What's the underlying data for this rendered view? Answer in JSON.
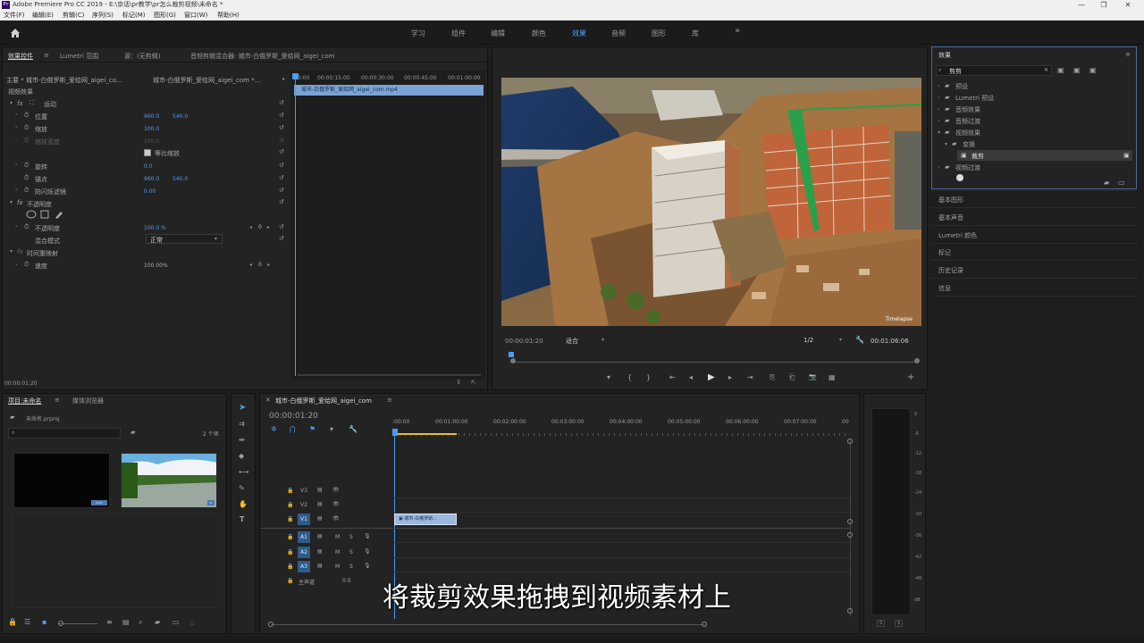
{
  "window": {
    "title": "Adobe Premiere Pro CC 2019 - E:\\京话\\pr教学\\pr怎么裁剪视频\\未命名 *",
    "app_icon": "Pr",
    "controls": [
      "—",
      "❐",
      "✕"
    ]
  },
  "menu": [
    "文件(F)",
    "编辑(E)",
    "剪辑(C)",
    "序列(S)",
    "标记(M)",
    "图形(G)",
    "窗口(W)",
    "帮助(H)"
  ],
  "workspaces": [
    "学习",
    "组件",
    "编辑",
    "颜色",
    "效果",
    "音频",
    "图形",
    "库"
  ],
  "workspace_more": "»",
  "effect_controls": {
    "tabs": [
      "效果控件",
      "Lumetri 范围",
      "源：(无剪辑)",
      "音频剪辑混合器: 城市-白俄罗斯_爱给网_aigei_com"
    ],
    "tab_menu": "≡",
    "master_label": "主要 * 城市-白俄罗斯_爱给网_aigei_co...",
    "clip_label": "城市-白俄罗斯_爱给网_aigei_com *...",
    "video_effects": "视频效果",
    "motion": "运动",
    "rows": [
      {
        "label": "位置",
        "v1": "960.0",
        "v2": "540.0"
      },
      {
        "label": "缩放",
        "v1": "100.0",
        "v2": ""
      },
      {
        "label": "缩放宽度",
        "v1": "100.0",
        "v2": ""
      },
      {
        "label": "等比缩放",
        "v1": "",
        "v2": ""
      },
      {
        "label": "旋转",
        "v1": "0.0",
        "v2": ""
      },
      {
        "label": "锚点",
        "v1": "960.0",
        "v2": "540.0"
      },
      {
        "label": "防闪烁滤镜",
        "v1": "0.00",
        "v2": ""
      }
    ],
    "opacity": "不透明度",
    "opacity_row": {
      "label": "不透明度",
      "value": "100.0 %"
    },
    "blend": {
      "label": "混合模式",
      "value": "正常"
    },
    "time_remap": "时间重映射",
    "speed": {
      "label": "速度",
      "value": "100.00%"
    },
    "keyframe_value": "0",
    "timecode": "00:00:01:20",
    "timeline_marks": [
      "00:00",
      "00:00:15:00",
      "00:00:30:00",
      "00:00:45:00",
      "00:01:00:00"
    ],
    "mini_clip": "城市-白俄罗斯_爱给网_aigei_com.mp4"
  },
  "program": {
    "watermark": "Timelapse",
    "timecode": "00:00:01:20",
    "fit": "适合",
    "resolution": "1/2",
    "duration": "00:01:06:06",
    "transport_icons": [
      "▾",
      "{",
      "}",
      "⇤",
      "◂",
      "▶",
      "▸",
      "⇥",
      "⎘",
      "⎗",
      "📷",
      "▦",
      "+"
    ]
  },
  "effects_panel": {
    "title": "效果",
    "menu": "≡",
    "search_value": "剪剪",
    "clear": "✕",
    "tree": [
      {
        "label": "预设",
        "level": 0
      },
      {
        "label": "Lumetri 预设",
        "level": 0
      },
      {
        "label": "音频效果",
        "level": 0
      },
      {
        "label": "音频过渡",
        "level": 0
      },
      {
        "label": "视频效果",
        "level": 0
      },
      {
        "label": "变换",
        "level": 1
      },
      {
        "label": "裁剪",
        "level": 2
      },
      {
        "label": "视频过渡",
        "level": 0
      }
    ],
    "side_panels": [
      "基本图形",
      "基本声音",
      "Lumetri 颜色",
      "标记",
      "历史记录",
      "信息"
    ]
  },
  "project": {
    "tabs": [
      "项目:未命名",
      "媒体浏览器"
    ],
    "file": "未命名.prproj",
    "count": "2 个项",
    "search_placeholder": "",
    "thumbs": [
      {
        "label": "",
        "badge": "▭▭"
      },
      {
        "label": "",
        "badge": "▭"
      }
    ]
  },
  "timeline": {
    "tab": "城市-白俄罗斯_爱给网_aigei_com",
    "timecode": "00:00:01:20",
    "ruler": [
      ":00:00",
      "00:01:00:00",
      "00:02:00:00",
      "00:03:00:00",
      "00:04:00:00",
      "00:05:00:00",
      "00:06:00:00",
      "00:07:00:00",
      "00"
    ],
    "tracks": [
      "V3",
      "V2",
      "V1",
      "A1",
      "A2",
      "A3"
    ],
    "master": {
      "label": "主声道",
      "value": "0.0"
    },
    "clip_label": "城市-白俄罗斯...",
    "track_flags": [
      "M",
      "S"
    ]
  },
  "subtitle": "将裁剪效果拖拽到视频素材上",
  "meter": {
    "ticks": [
      "0",
      "-6",
      "-12",
      "-18",
      "-24",
      "-30",
      "-36",
      "-42",
      "-48",
      "dB"
    ],
    "solo": [
      "S",
      "S"
    ]
  }
}
